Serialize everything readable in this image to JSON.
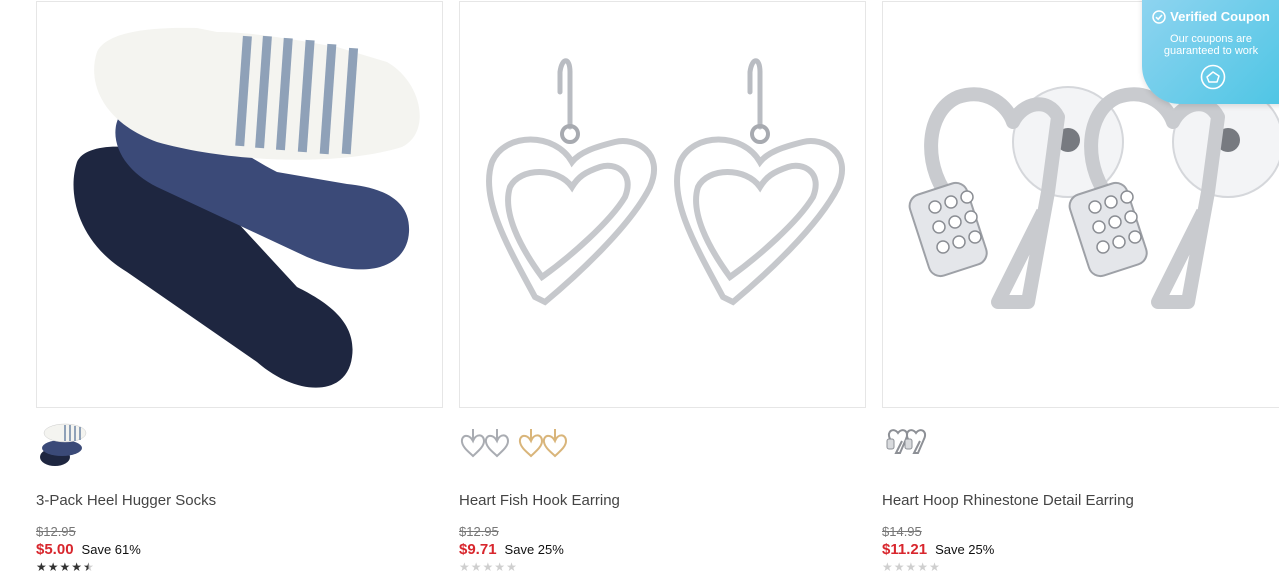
{
  "products": [
    {
      "name": "3-Pack Heel Hugger Socks",
      "original_price": "$12.95",
      "sale_price": "$5.00",
      "save_text": "Save 61%",
      "rating": 4.5,
      "swatches": [
        "white-blue-navy"
      ]
    },
    {
      "name": "Heart Fish Hook Earring",
      "original_price": "$12.95",
      "sale_price": "$9.71",
      "save_text": "Save 25%",
      "rating": 0,
      "swatches": [
        "silver",
        "gold"
      ]
    },
    {
      "name": "Heart Hoop Rhinestone Detail Earring",
      "original_price": "$14.95",
      "sale_price": "$11.21",
      "save_text": "Save 25%",
      "rating": 0,
      "swatches": [
        "silver"
      ]
    }
  ],
  "coupon_badge": {
    "title": "Verified Coupon",
    "line1": "Our coupons are",
    "line2": "guaranteed to work"
  },
  "colors": {
    "sale_price": "#d8262d",
    "coupon_bg": "#4cc5e4"
  }
}
